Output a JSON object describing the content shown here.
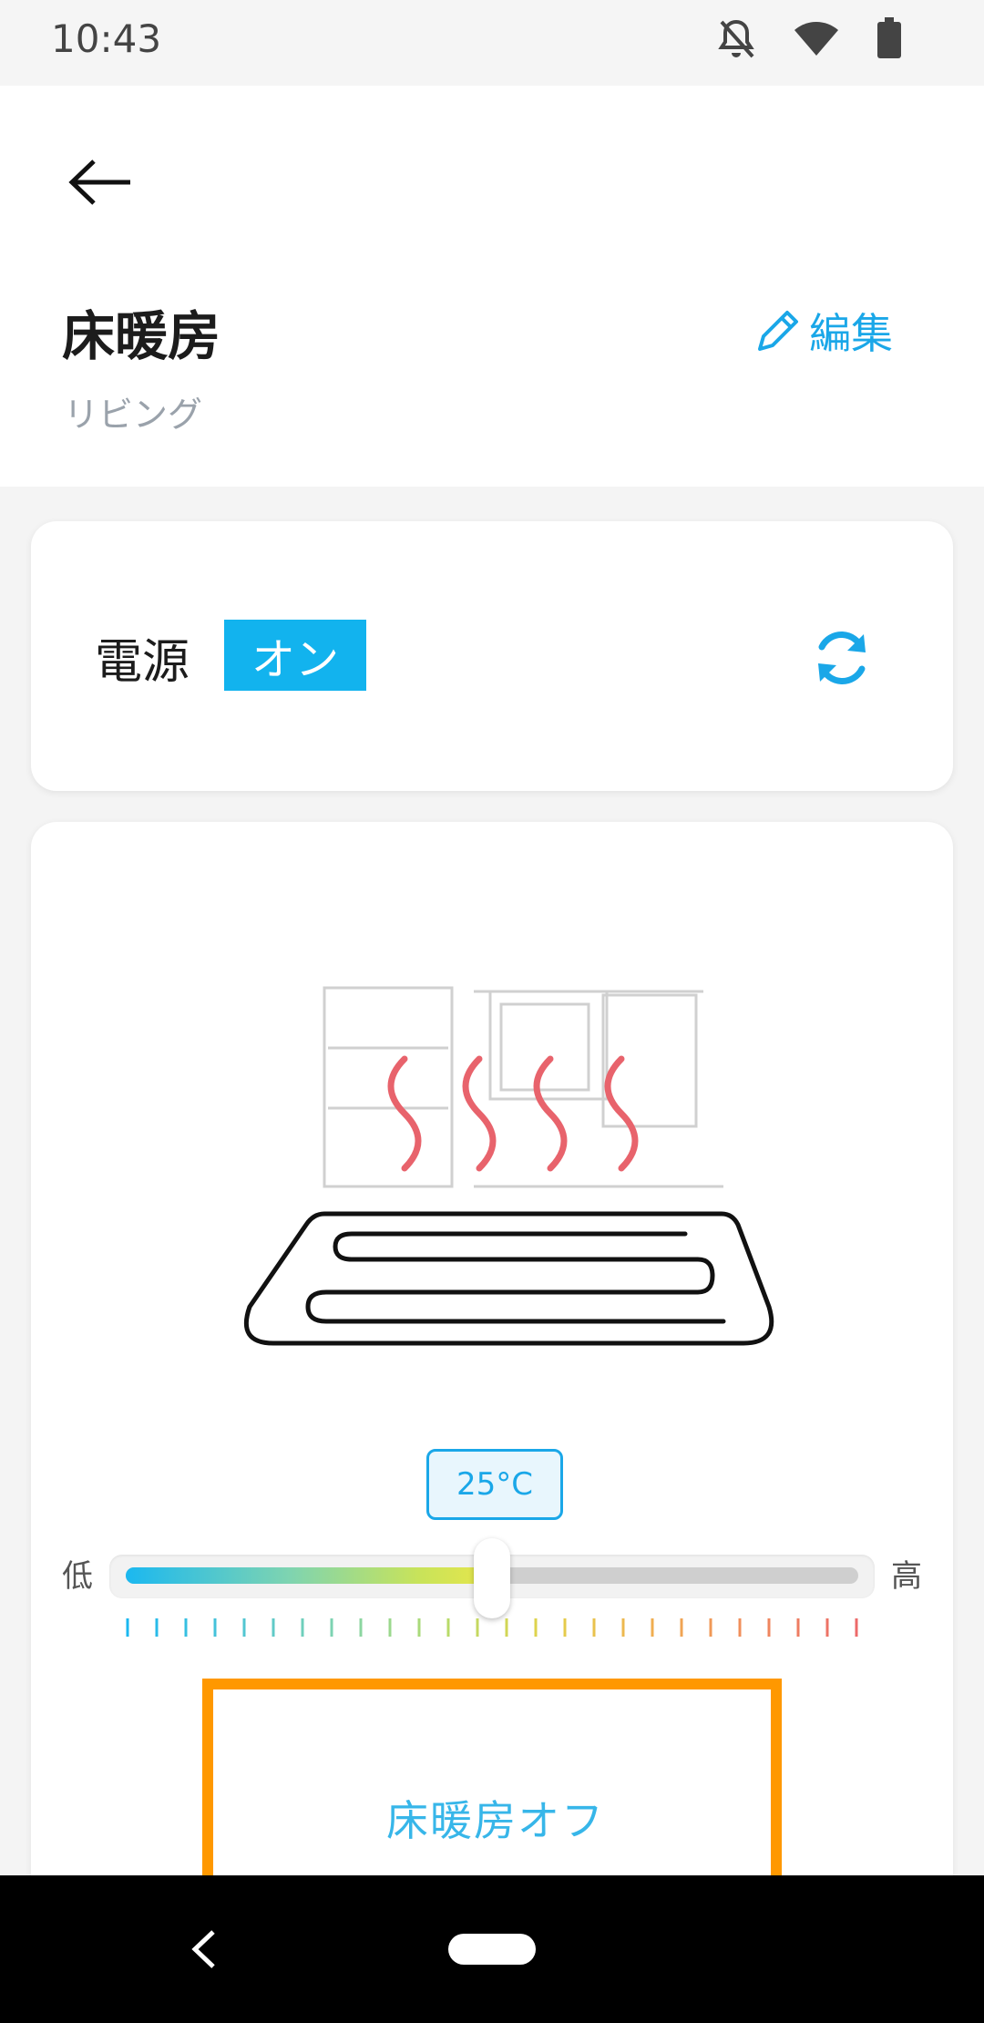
{
  "status_bar": {
    "time": "10:43"
  },
  "header": {
    "title": "床暖房",
    "subtitle": "リビング",
    "edit_label": "編集"
  },
  "power": {
    "label": "電源",
    "state": "オン"
  },
  "temperature": {
    "value_label": "25°C",
    "low_label": "低",
    "high_label": "高",
    "level": 0.5
  },
  "action": {
    "off_label": "床暖房オフ"
  },
  "colors": {
    "accent": "#1aa7e8",
    "badge": "#12b3ee",
    "highlight": "#ff9800",
    "heat_wave": "#e8636c"
  }
}
